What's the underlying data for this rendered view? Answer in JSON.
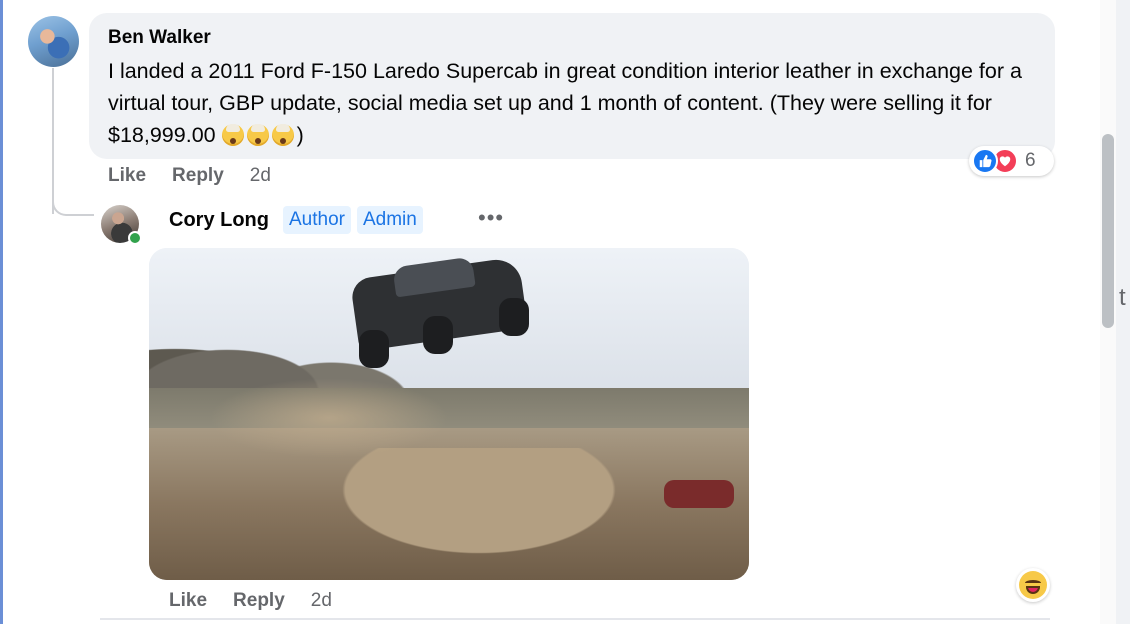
{
  "comment": {
    "author": "Ben Walker",
    "text": "I landed a 2011 Ford F-150 Laredo Supercab in great condition interior leather in exchange for a virtual tour, GBP update, social media set up and 1 month of content. (They were selling it for $18,999.00 ",
    "text_end": ")",
    "emoji_icons": [
      "exploding-head-icon",
      "exploding-head-icon",
      "exploding-head-icon"
    ],
    "actions": {
      "like": "Like",
      "reply": "Reply",
      "time": "2d"
    },
    "reactions": {
      "icons": [
        "like-icon",
        "love-icon"
      ],
      "count": "6"
    }
  },
  "reply": {
    "author": "Cory Long",
    "badges": [
      "Author",
      "Admin"
    ],
    "more_label": "•••",
    "attachment_icon": "gif-truck-jump",
    "actions": {
      "like": "Like",
      "reply": "Reply",
      "time": "2d"
    },
    "reaction_icon": "haha-icon"
  },
  "right_edge_char": "t",
  "colors": {
    "accent": "#1b74e4",
    "bubble": "#f0f2f5",
    "meta": "#65676b",
    "like": "#1877f2",
    "love": "#f33e58"
  }
}
